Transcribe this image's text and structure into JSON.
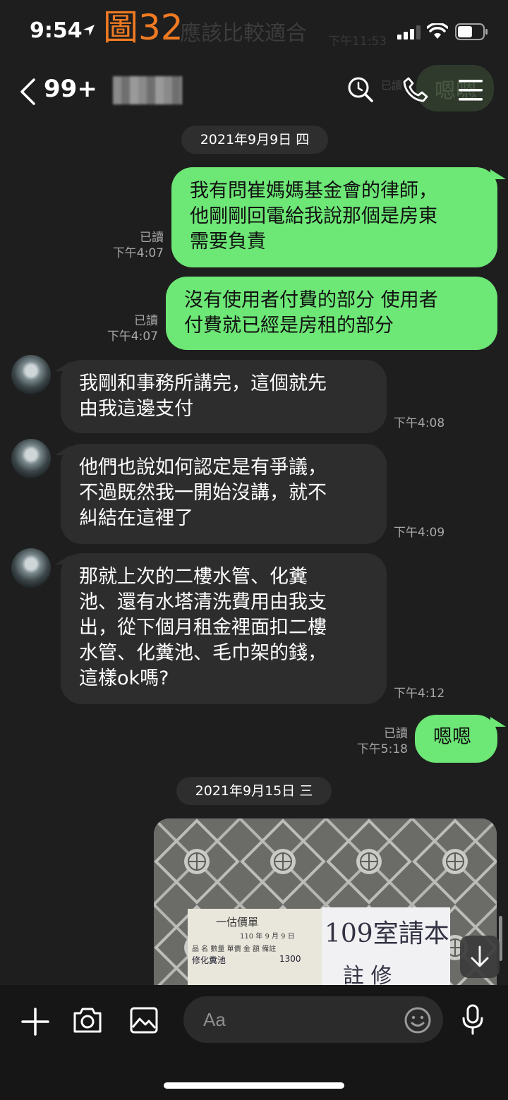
{
  "status_bar": {
    "time": "9:54",
    "annotation_label": "圖32",
    "overlapped_preview_text": "應該比較適合",
    "overlapped_preview_time": "下午11:53",
    "annotation_color": "#ef7a22"
  },
  "header": {
    "unread_count": "99+",
    "contact_name": "",
    "overlapped_read": "已讀",
    "overlapped_bubble_text": "嗯嗯"
  },
  "chat": {
    "date_1": "2021年9月9日 四",
    "date_2": "2021年9月15日 三",
    "messages": [
      {
        "side": "out",
        "lines": [
          "我有問崔媽媽基金會的律師，",
          "他剛剛回電給我說那個是房東",
          "需要負責"
        ],
        "read": "已讀",
        "time": "下午4:07"
      },
      {
        "side": "out",
        "lines": [
          "沒有使用者付費的部分 使用者",
          "付費就已經是房租的部分"
        ],
        "read": "已讀",
        "time": "下午4:07"
      },
      {
        "side": "in",
        "lines": [
          "我剛和事務所講完，這個就先",
          "由我這邊支付"
        ],
        "time": "下午4:08"
      },
      {
        "side": "in",
        "lines": [
          "他們也說如何認定是有爭議，",
          "不過既然我一開始沒講，就不",
          "糾結在這裡了"
        ],
        "time": "下午4:09"
      },
      {
        "side": "in",
        "lines": [
          "那就上次的二樓水管、化糞",
          "池、還有水塔清洗費用由我支",
          "出，從下個月租金裡面扣二樓",
          "水管、化糞池、毛巾架的錢，",
          "這樣ok嗎?"
        ],
        "time": "下午4:12"
      },
      {
        "side": "out",
        "lines": [
          "嗯嗯"
        ],
        "read": "已讀",
        "time": "下午5:18"
      }
    ],
    "photo": {
      "receipt_title": "一估價單",
      "receipt_no": "110 年 9 月 9 日",
      "receipt_header": "品  名 數量 單價 金  額 備註",
      "receipt_item": "修化糞池",
      "receipt_price": "1300",
      "note_line1": "109室請本",
      "note_line2": "註 修"
    }
  },
  "input_bar": {
    "placeholder": "Aa"
  },
  "colors": {
    "outgoing_bubble": "#6de776",
    "incoming_bubble": "#2d2d2d",
    "background": "#1e1e1e"
  }
}
